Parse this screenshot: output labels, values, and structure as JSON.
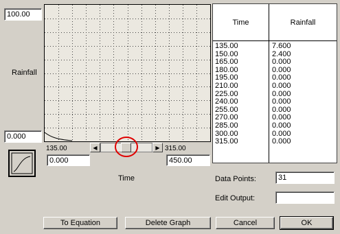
{
  "graph": {
    "y_max": "100.00",
    "y_label": "Rainfall",
    "y_min": "0.000",
    "x_start_label": "135.00",
    "x_end_label": "315.00",
    "x_min_field": "0.000",
    "x_max_field": "450.00",
    "x_label": "Time"
  },
  "table": {
    "col_time": "Time",
    "col_rainfall": "Rainfall",
    "rows": [
      [
        "135.00",
        "7.600"
      ],
      [
        "150.00",
        "2.400"
      ],
      [
        "165.00",
        "0.000"
      ],
      [
        "180.00",
        "0.000"
      ],
      [
        "195.00",
        "0.000"
      ],
      [
        "210.00",
        "0.000"
      ],
      [
        "225.00",
        "0.000"
      ],
      [
        "240.00",
        "0.000"
      ],
      [
        "255.00",
        "0.000"
      ],
      [
        "270.00",
        "0.000"
      ],
      [
        "285.00",
        "0.000"
      ],
      [
        "300.00",
        "0.000"
      ],
      [
        "315.00",
        "0.000"
      ]
    ]
  },
  "data_points": {
    "label": "Data Points:",
    "value": "31"
  },
  "edit_output": {
    "label": "Edit Output:",
    "value": ""
  },
  "buttons": {
    "to_equation": "To Equation",
    "delete_graph": "Delete Graph",
    "cancel": "Cancel",
    "ok": "OK"
  },
  "colors": {
    "highlight_circle": "#e00000",
    "plot_bg": "#ebe8e0"
  }
}
